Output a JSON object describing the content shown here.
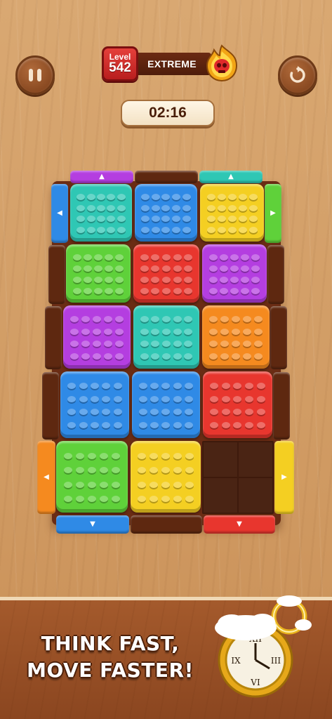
{
  "header": {
    "level_word": "Level",
    "level_number": "542",
    "difficulty": "EXTREME",
    "timer": "02:16"
  },
  "controls": {
    "pause_icon": "pause-icon",
    "restart_icon": "restart-icon"
  },
  "board": {
    "rows": [
      [
        "teal",
        "blue",
        "yellow"
      ],
      [
        "green",
        "red",
        "purple"
      ],
      [
        "purple",
        "teal",
        "orange"
      ],
      [
        "blue",
        "blue",
        "red"
      ],
      [
        "green",
        "yellow",
        "empty"
      ]
    ],
    "colors": {
      "teal": "#2fc7b4",
      "blue": "#2f8ae6",
      "yellow": "#f4cf22",
      "green": "#5fd13a",
      "red": "#e8362e",
      "purple": "#b43ee0",
      "orange": "#f58a1f",
      "wood": "#6a2c14"
    },
    "rails": {
      "top": [
        "purple",
        "wood",
        "teal"
      ],
      "bottom": [
        "blue",
        "wood",
        "red"
      ],
      "left": [
        "blue",
        "wood",
        "wood",
        "wood",
        "orange"
      ],
      "right": [
        "green",
        "wood",
        "wood",
        "wood",
        "yellow"
      ]
    }
  },
  "promo": {
    "line1": "THINK FAST,",
    "line2": "MOVE FASTER!"
  }
}
